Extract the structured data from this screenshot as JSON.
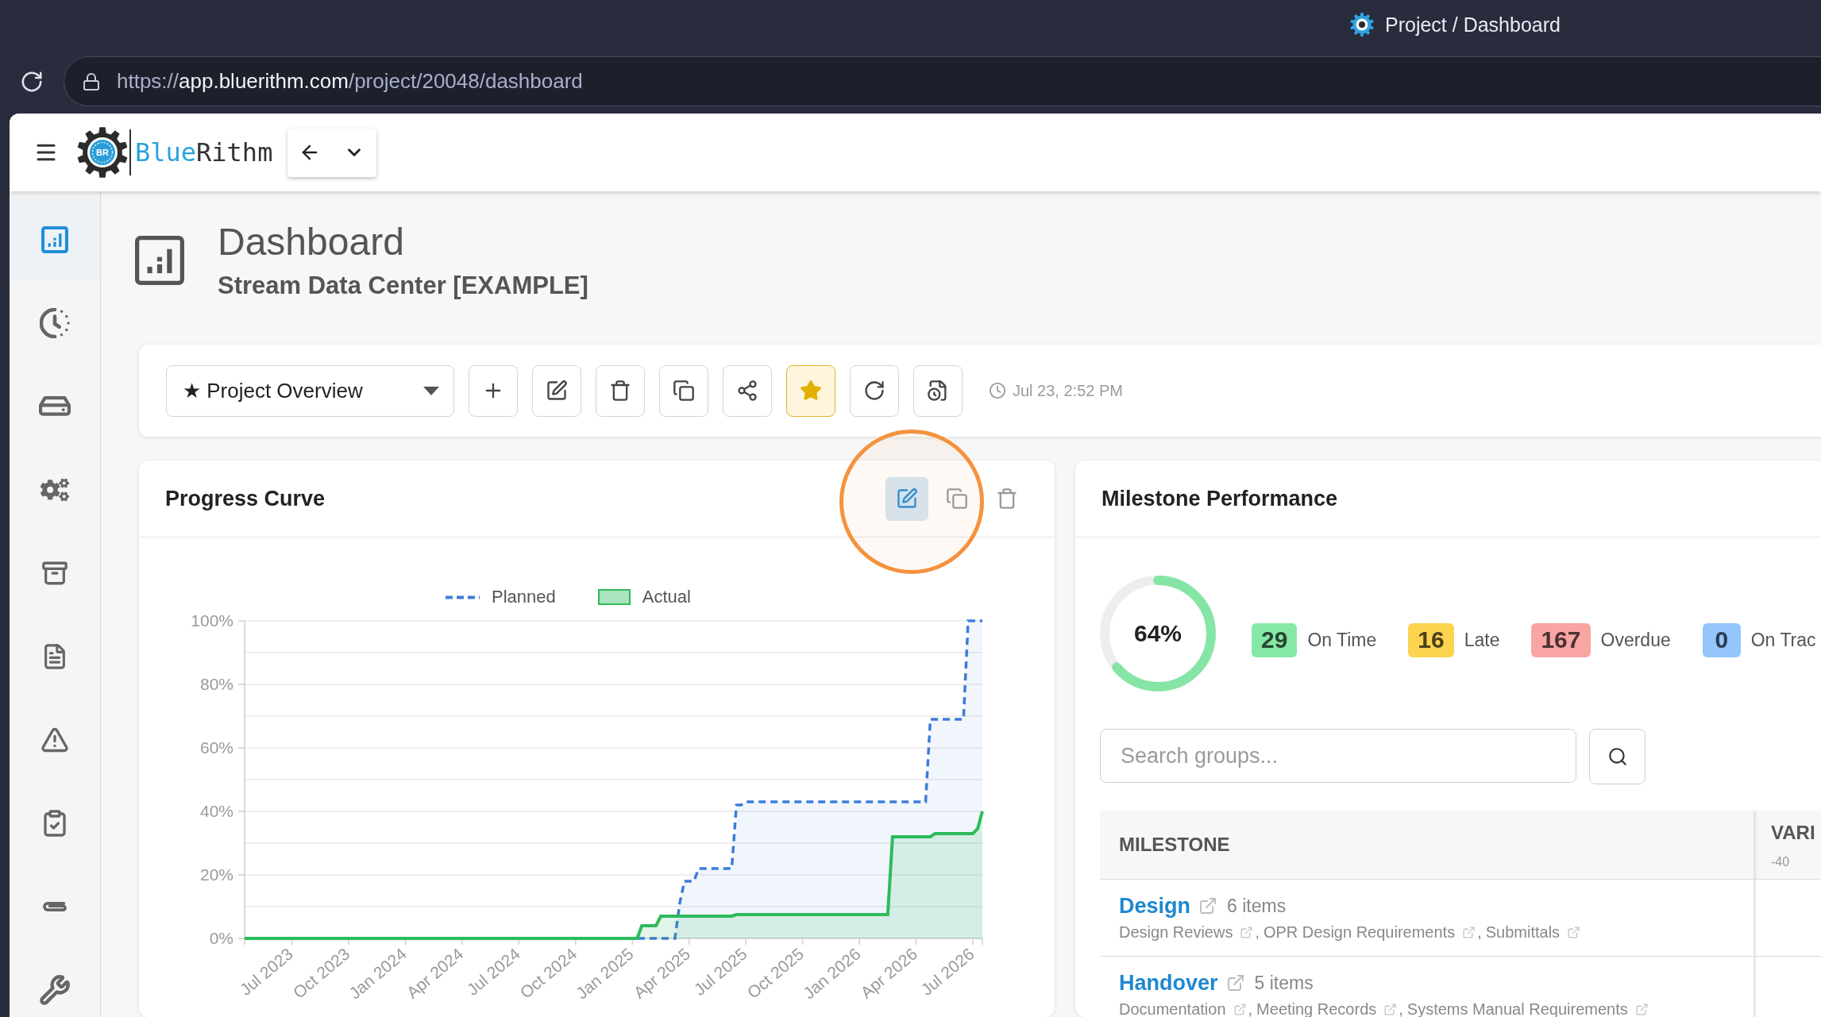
{
  "browser": {
    "tab_title": "Project / Dashboard",
    "url": {
      "scheme": "https://",
      "host": "app.bluerithm.com",
      "path": "/project/20048/dashboard"
    }
  },
  "app_header": {
    "logo_mark": "BR",
    "brand": {
      "first": "Blue",
      "second": "Rithm"
    }
  },
  "sidebar": {
    "items": [
      {
        "selected": true
      },
      {
        "selected": false
      },
      {
        "selected": false
      },
      {
        "selected": false
      },
      {
        "selected": false
      },
      {
        "selected": false
      },
      {
        "selected": false
      },
      {
        "selected": false
      },
      {
        "selected": false
      },
      {
        "selected": false
      }
    ]
  },
  "page_header": {
    "title": "Dashboard",
    "subtitle": "Stream Data Center [EXAMPLE]"
  },
  "toolbar": {
    "dashboard_select": {
      "value": "★ Project Overview"
    },
    "buttons": [
      {
        "active": false
      },
      {
        "active": false
      },
      {
        "active": false
      },
      {
        "active": false
      },
      {
        "active": false
      },
      {
        "active": true
      },
      {
        "active": false
      },
      {
        "active": false
      }
    ],
    "updated": "Jul 23, 2:52 PM"
  },
  "progress_curve": {
    "title": "Progress Curve",
    "actions": [
      {
        "active": true
      },
      {
        "active": false
      },
      {
        "active": false
      }
    ],
    "callout_ring": true,
    "chart_data": {
      "type": "area",
      "stacked": false,
      "grid": true,
      "legend": "top",
      "categories": [
        null,
        null,
        null,
        null,
        null,
        null,
        null,
        null,
        null,
        null,
        "Jul 2023",
        null,
        null,
        null,
        null,
        null,
        null,
        null,
        null,
        null,
        null,
        null,
        "Oct 2023",
        null,
        null,
        null,
        null,
        null,
        null,
        null,
        null,
        null,
        null,
        null,
        "Jan 2024",
        null,
        null,
        null,
        null,
        null,
        null,
        null,
        null,
        null,
        null,
        null,
        "Apr 2024",
        null,
        null,
        null,
        null,
        null,
        null,
        null,
        null,
        null,
        null,
        null,
        "Jul 2024",
        null,
        null,
        null,
        null,
        null,
        null,
        null,
        null,
        null,
        null,
        null,
        "Oct 2024",
        null,
        null,
        null,
        null,
        null,
        null,
        null,
        null,
        null,
        null,
        null,
        "Jan 2025",
        null,
        null,
        null,
        null,
        null,
        null,
        null,
        null,
        null,
        null,
        null,
        "Apr 2025",
        null,
        null,
        null,
        null,
        null,
        null,
        null,
        null,
        null,
        null,
        null,
        "Jul 2025",
        null,
        null,
        null,
        null,
        null,
        null,
        null,
        null,
        null,
        null,
        null,
        "Oct 2025",
        null,
        null,
        null,
        null,
        null,
        null,
        null,
        null,
        null,
        null,
        null,
        "Jan 2026",
        null,
        null,
        null,
        null,
        null,
        null,
        null,
        null,
        null,
        null,
        null,
        "Apr 2026",
        null,
        null,
        null,
        null,
        null,
        null,
        null,
        null,
        null,
        null,
        null,
        "Jul 2026",
        null,
        null
      ],
      "series": [
        {
          "name": "Planned",
          "color": "#3b7dd8",
          "values": [
            0,
            0,
            0,
            0,
            0,
            0,
            0,
            0,
            0,
            0,
            0,
            0,
            0,
            0,
            0,
            0,
            0,
            0,
            0,
            0,
            0,
            0,
            0,
            0,
            0,
            0,
            0,
            0,
            0,
            0,
            0,
            0,
            0,
            0,
            0,
            0,
            0,
            0,
            0,
            0,
            0,
            0,
            0,
            0,
            0,
            0,
            0,
            0,
            0,
            0,
            0,
            0,
            0,
            0,
            0,
            0,
            0,
            0,
            0,
            0,
            0,
            0,
            0,
            0,
            0,
            0,
            0,
            0,
            0,
            0,
            0,
            0,
            0,
            0,
            0,
            0,
            0,
            0,
            0,
            0,
            0,
            0,
            0,
            0,
            0,
            0,
            0,
            0,
            0,
            0,
            0,
            0,
            11,
            18,
            18,
            18,
            22,
            22,
            22,
            22,
            22,
            22,
            22,
            22,
            42,
            42,
            43,
            43,
            43,
            43,
            43,
            43,
            43,
            43,
            43,
            43,
            43,
            43,
            43,
            43,
            43,
            43,
            43,
            43,
            43,
            43,
            43,
            43,
            43,
            43,
            43,
            43,
            43,
            43,
            43,
            43,
            43,
            43,
            43,
            43,
            43,
            43,
            43,
            43,
            43,
            69,
            69,
            69,
            69,
            69,
            69,
            69,
            69,
            100,
            100,
            100,
            100
          ]
        },
        {
          "name": "Actual",
          "color": "#2dbb5d",
          "values": [
            0,
            0,
            0,
            0,
            0,
            0,
            0,
            0,
            0,
            0,
            0,
            0,
            0,
            0,
            0,
            0,
            0,
            0,
            0,
            0,
            0,
            0,
            0,
            0,
            0,
            0,
            0,
            0,
            0,
            0,
            0,
            0,
            0,
            0,
            0,
            0,
            0,
            0,
            0,
            0,
            0,
            0,
            0,
            0,
            0,
            0,
            0,
            0,
            0,
            0,
            0,
            0,
            0,
            0,
            0,
            0,
            0,
            0,
            0,
            0,
            0,
            0,
            0,
            0,
            0,
            0,
            0,
            0,
            0,
            0,
            0,
            0,
            0,
            0,
            0,
            0,
            0,
            0,
            0,
            0,
            0,
            0,
            0,
            0,
            4,
            4,
            4,
            4,
            7,
            7,
            7,
            7,
            7,
            7,
            7,
            7,
            7,
            7,
            7,
            7,
            7,
            7,
            7,
            7,
            7.5,
            7.5,
            7.5,
            7.5,
            7.5,
            7.5,
            7.5,
            7.5,
            7.5,
            7.5,
            7.5,
            7.5,
            7.5,
            7.5,
            7.5,
            7.5,
            7.5,
            7.5,
            7.5,
            7.5,
            7.5,
            7.5,
            7.5,
            7.5,
            7.5,
            7.5,
            7.5,
            7.5,
            7.5,
            7.5,
            7.5,
            7.5,
            7.5,
            32,
            32,
            32,
            32,
            32,
            32,
            32,
            32,
            32,
            33,
            33,
            33,
            33,
            33,
            33,
            33,
            33,
            33,
            34.5,
            40
          ]
        }
      ],
      "ylim": [
        0,
        100
      ],
      "yticks": [
        {
          "value": 0,
          "label": "0%"
        },
        {
          "value": 20,
          "label": "20%"
        },
        {
          "value": 40,
          "label": "40%"
        },
        {
          "value": 60,
          "label": "60%"
        },
        {
          "value": 80,
          "label": "80%"
        },
        {
          "value": 100,
          "label": "100%"
        }
      ]
    }
  },
  "milestone_performance": {
    "title": "Milestone Performance",
    "completion": {
      "level": 0.64,
      "label": "64%"
    },
    "status_counts": [
      {
        "count": "29",
        "label": "On Time",
        "color": "#86e8a5"
      },
      {
        "count": "16",
        "label": "Late",
        "color": "#fcd44f"
      },
      {
        "count": "167",
        "label": "Overdue",
        "color": "#f9a5a4"
      },
      {
        "count": "0",
        "label": "On Trac",
        "color": "#94c5fb"
      }
    ],
    "search": {
      "placeholder": "Search groups..."
    },
    "table": {
      "columns": [
        {
          "label": "MILESTONE"
        },
        {
          "label": "VARI",
          "sub_label": "-40"
        }
      ],
      "rows": [
        {
          "name": "Design",
          "count": "6 items",
          "separator": ",",
          "links": [
            "Design Reviews",
            "OPR Design Requirements",
            "Submittals"
          ]
        },
        {
          "name": "Handover",
          "count": "5 items",
          "separator": ",",
          "links": [
            "Documentation",
            "Meeting Records",
            "Systems Manual Requirements"
          ]
        }
      ]
    }
  }
}
